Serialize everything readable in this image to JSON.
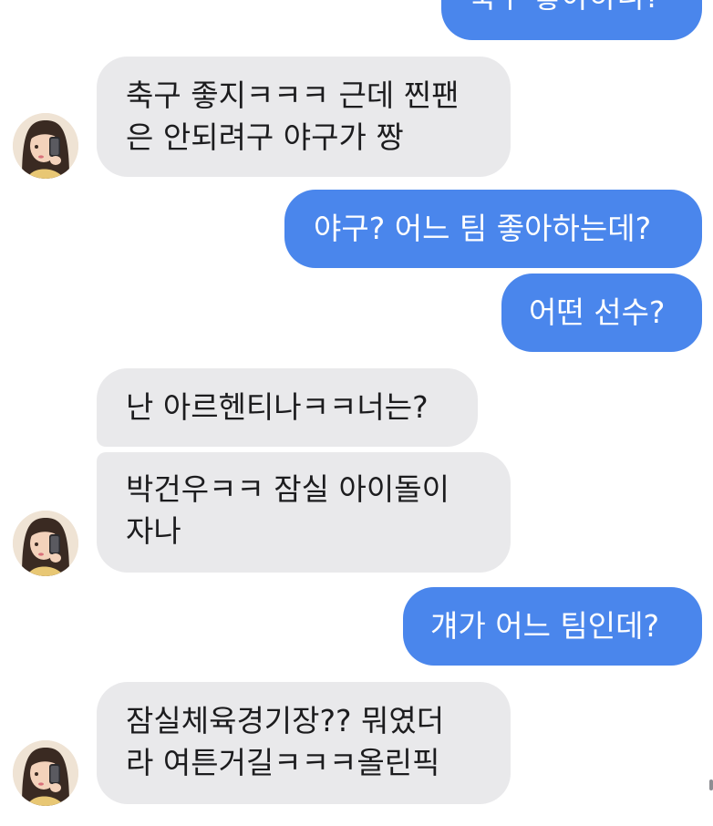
{
  "conversation": {
    "messages": [
      {
        "direction": "outgoing",
        "text": "축구 좋아하니?"
      },
      {
        "direction": "incoming",
        "text": "축구 좋지ㅋㅋㅋ 근데 찐팬\n은 안되려구 야구가 짱"
      },
      {
        "direction": "outgoing",
        "text": "야구? 어느 팀 좋아하는데?"
      },
      {
        "direction": "outgoing",
        "text": "어떤 선수?"
      },
      {
        "direction": "incoming",
        "text": "난 아르헨티나ㅋㅋ너는?"
      },
      {
        "direction": "incoming",
        "text": "박건우ㅋㅋ 잠실 아이돌이\n자나"
      },
      {
        "direction": "outgoing",
        "text": "걔가 어느 팀인데?"
      },
      {
        "direction": "incoming",
        "text": "잠실체육경기장?? 뭐였더\n라 여튼거길ㅋㅋㅋ올린픽"
      }
    ]
  },
  "colors": {
    "outgoing_bubble": "#4a86ec",
    "incoming_bubble": "#e9e9eb",
    "outgoing_text": "#ffffff",
    "incoming_text": "#1c1c1e"
  }
}
